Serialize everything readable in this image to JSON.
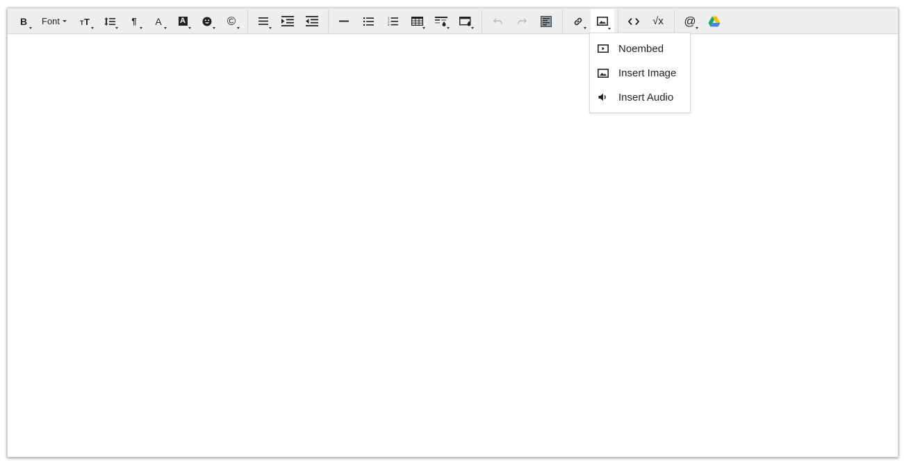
{
  "toolbar": {
    "bold": "B",
    "font": "Font",
    "font_size": "ᴛT",
    "paragraph": "¶",
    "text_color": "A",
    "highlight": "A",
    "copyright": "©",
    "math": "√x",
    "mention": "@",
    "code": "<>"
  },
  "dropdown": {
    "items": [
      {
        "label": "Noembed",
        "icon": "embed-icon"
      },
      {
        "label": "Insert Image",
        "icon": "image-icon"
      },
      {
        "label": "Insert Audio",
        "icon": "audio-icon"
      }
    ]
  },
  "colors": {
    "toolbar_bg": "#eceeef",
    "icon": "#222222",
    "disabled_icon": "#aeb2b5",
    "drive_green": "#1ea362",
    "drive_yellow": "#ffba00",
    "drive_blue": "#4285f4"
  }
}
